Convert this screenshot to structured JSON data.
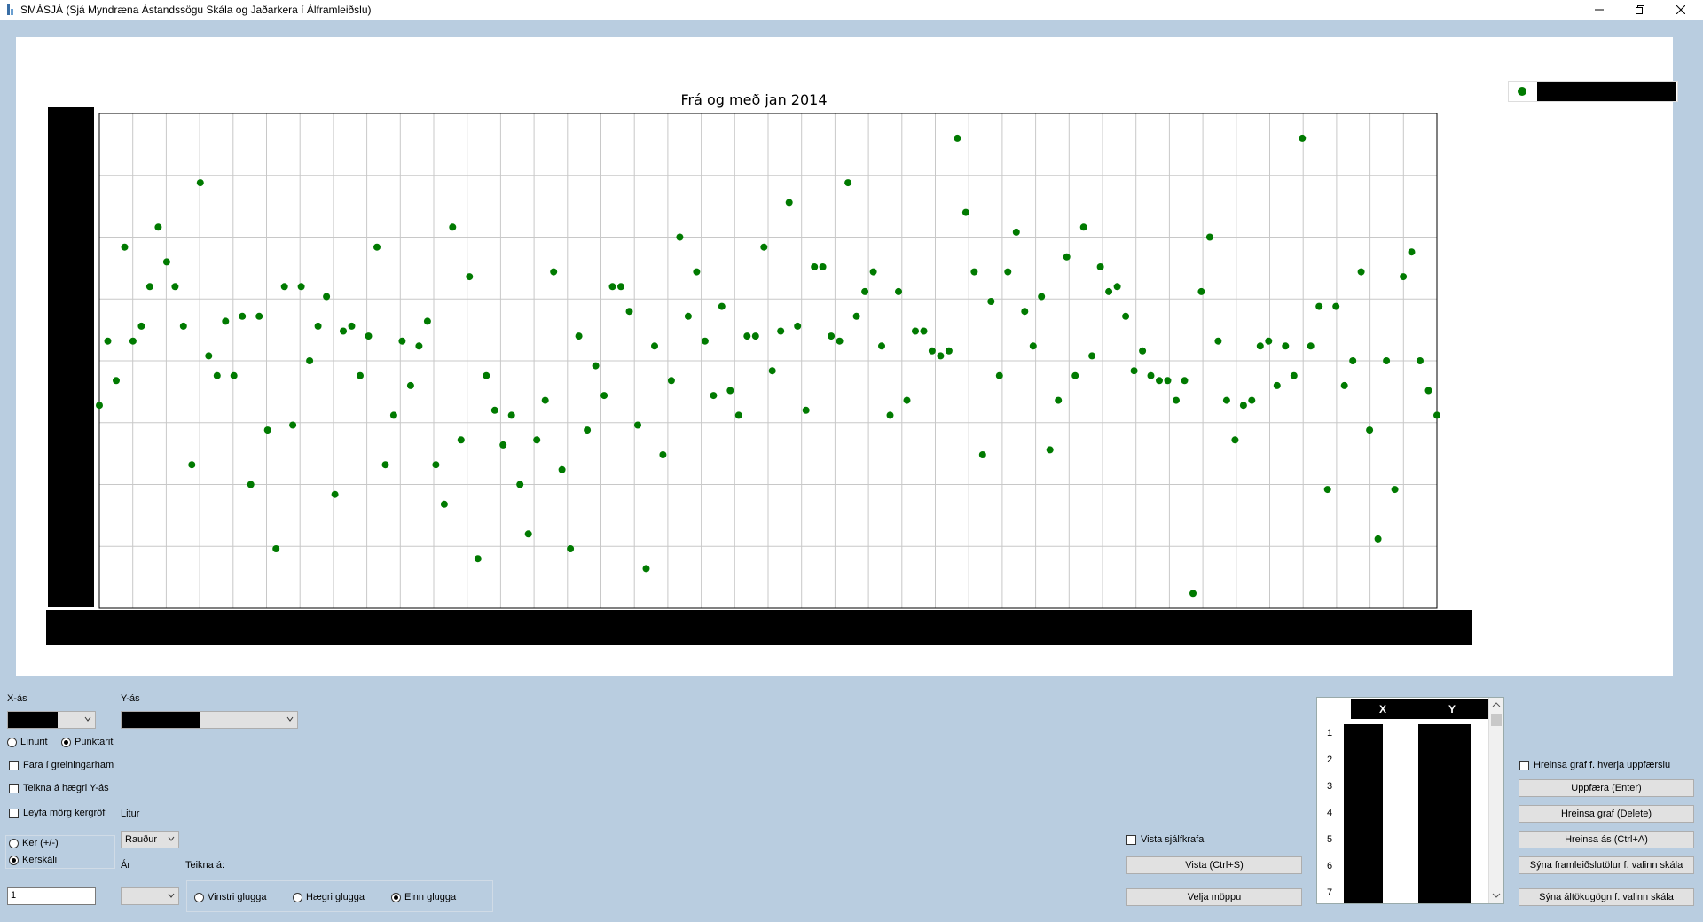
{
  "window": {
    "title": "SMÁSJÁ (Sjá Myndræna Ástandssögu Skála og Jaðarkera í Álframleiðslu)",
    "minimize_icon": "minimize-icon",
    "restore_icon": "restore-icon",
    "close_icon": "close-icon"
  },
  "chart_data": {
    "type": "scatter",
    "title": "Frá og með jan 2014",
    "grid": true,
    "legend": "top-right",
    "color": "#007a00",
    "y_normalized_note_hidden": true,
    "points": [
      0.41,
      0.54,
      0.46,
      0.73,
      0.54,
      0.57,
      0.65,
      0.77,
      0.7,
      0.65,
      0.57,
      0.29,
      0.86,
      0.51,
      0.47,
      0.58,
      0.47,
      0.59,
      0.25,
      0.59,
      0.36,
      0.12,
      0.65,
      0.37,
      0.65,
      0.5,
      0.57,
      0.63,
      0.23,
      0.56,
      0.57,
      0.47,
      0.55,
      0.73,
      0.29,
      0.39,
      0.54,
      0.45,
      0.53,
      0.58,
      0.29,
      0.21,
      0.77,
      0.34,
      0.67,
      0.1,
      0.47,
      0.4,
      0.33,
      0.39,
      0.25,
      0.15,
      0.34,
      0.42,
      0.68,
      0.28,
      0.12,
      0.55,
      0.36,
      0.49,
      0.43,
      0.65,
      0.65,
      0.6,
      0.37,
      0.08,
      0.53,
      0.31,
      0.46,
      0.75,
      0.59,
      0.68,
      0.54,
      0.43,
      0.61,
      0.44,
      0.39,
      0.55,
      0.55,
      0.73,
      0.48,
      0.56,
      0.82,
      0.57,
      0.4,
      0.69,
      0.69,
      0.55,
      0.54,
      0.86,
      0.59,
      0.64,
      0.68,
      0.53,
      0.39,
      0.64,
      0.42,
      0.56,
      0.56,
      0.52,
      0.51,
      0.52,
      0.95,
      0.8,
      0.68,
      0.31,
      0.62,
      0.47,
      0.68,
      0.76,
      0.6,
      0.53,
      0.63,
      0.32,
      0.42,
      0.71,
      0.47,
      0.77,
      0.51,
      0.69,
      0.64,
      0.65,
      0.59,
      0.48,
      0.52,
      0.47,
      0.46,
      0.46,
      0.42,
      0.46,
      0.03,
      0.64,
      0.75,
      0.54,
      0.42,
      0.34,
      0.41,
      0.42,
      0.53,
      0.54,
      0.45,
      0.53,
      0.47,
      0.95,
      0.53,
      0.61,
      0.24,
      0.61,
      0.45,
      0.5,
      0.68,
      0.36,
      0.14,
      0.5,
      0.24,
      0.67,
      0.72,
      0.5,
      0.44,
      0.39
    ]
  },
  "legend": {
    "marker_icon": "legend-dot-icon"
  },
  "controls": {
    "x_axis_label": "X-ás",
    "y_axis_label": "Y-ás",
    "plot_line": "Línurit",
    "plot_points": "Punktarit",
    "analysis_mode": "Fara í greiningarham",
    "right_y_axis": "Teikna á hægri Y-ás",
    "allow_many": "Leyfa mörg kergröf",
    "color_label": "Litur",
    "color_value": "Rauður",
    "pot_label": "Ker (+/-)",
    "potline_label": "Kerskáli",
    "year_label": "Ár",
    "draw_on_label": "Teikna á:",
    "left_window": "Vinstri glugga",
    "right_window": "Hægri glugga",
    "one_window": "Einn glugga",
    "number_value": "1",
    "save_auto": "Vista sjálfkrafa",
    "save_button": "Vista (Ctrl+S)",
    "choose_folder": "Velja möppu"
  },
  "table": {
    "col_x": "X",
    "col_y": "Y",
    "rows": [
      "1",
      "2",
      "3",
      "4",
      "5",
      "6",
      "7"
    ]
  },
  "right_panel": {
    "clear_each_update": "Hreinsa graf f. hverja uppfærslu",
    "update": "Uppfæra (Enter)",
    "clear_graph": "Hreinsa graf (Delete)",
    "clear_axis": "Hreinsa ás (Ctrl+A)",
    "show_production": "Sýna framleiðslutölur f. valinn skála",
    "show_alumina": "Sýna áltökugögn f. valinn skála"
  }
}
